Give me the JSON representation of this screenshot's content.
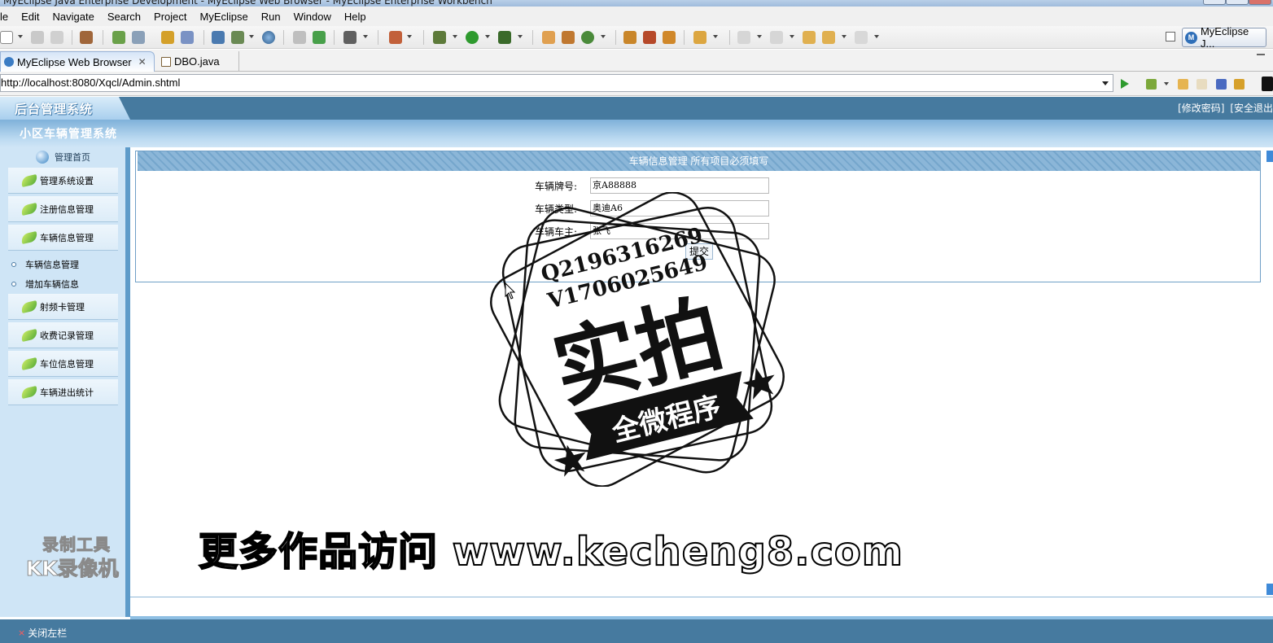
{
  "window": {
    "title": "MyEclipse Java Enterprise Development - MyEclipse Web Browser - MyEclipse Enterprise Workbench"
  },
  "menu": {
    "items": [
      "le",
      "Edit",
      "Navigate",
      "Search",
      "Project",
      "MyEclipse",
      "Run",
      "Window",
      "Help"
    ]
  },
  "perspective": {
    "label": "MyEclipse J..."
  },
  "editor_tabs": [
    {
      "label": "MyEclipse Web Browser",
      "active": true
    },
    {
      "label": "DBO.java",
      "active": false
    }
  ],
  "browser": {
    "url": "http://localhost:8080/Xqcl/Admin.shtml"
  },
  "site": {
    "logo": "后台管理系统",
    "subtitle": "小区车辆管理系统",
    "top_links": [
      "[修改密码]",
      "[安全退出"
    ]
  },
  "sidebar": {
    "home": "管理首页",
    "items": [
      {
        "label": "管理系统设置"
      },
      {
        "label": "注册信息管理"
      },
      {
        "label": "车辆信息管理"
      },
      {
        "label": "射频卡管理"
      },
      {
        "label": "收费记录管理"
      },
      {
        "label": "车位信息管理"
      },
      {
        "label": "车辆进出统计"
      }
    ],
    "sub_items": [
      {
        "label": "车辆信息管理"
      },
      {
        "label": "增加车辆信息"
      }
    ],
    "watermark_line1": "录制工具",
    "watermark_line2": "KK录像机"
  },
  "form": {
    "header": "车辆信息管理  所有项目必须填写",
    "fields": [
      {
        "label": "车辆牌号:",
        "value": "京A88888"
      },
      {
        "label": "车辆类型:",
        "value": "奥迪A6"
      },
      {
        "label": "车辆车主:",
        "value": "张飞"
      }
    ],
    "submit_label": "提交"
  },
  "footer": {
    "close_left_label": "关闭左栏",
    "close_icon": "×"
  },
  "overlays": {
    "site_watermark": "更多作品访问 www.kecheng8.com",
    "stamp_q": "Q2196316269",
    "stamp_v": "V1706025649",
    "stamp_main": "实拍",
    "stamp_banner": "全微程序"
  },
  "colors": {
    "page_topbar": "#467a9f",
    "sidebar_bg": "#cfe5f6",
    "form_header": "#7aaad0"
  }
}
